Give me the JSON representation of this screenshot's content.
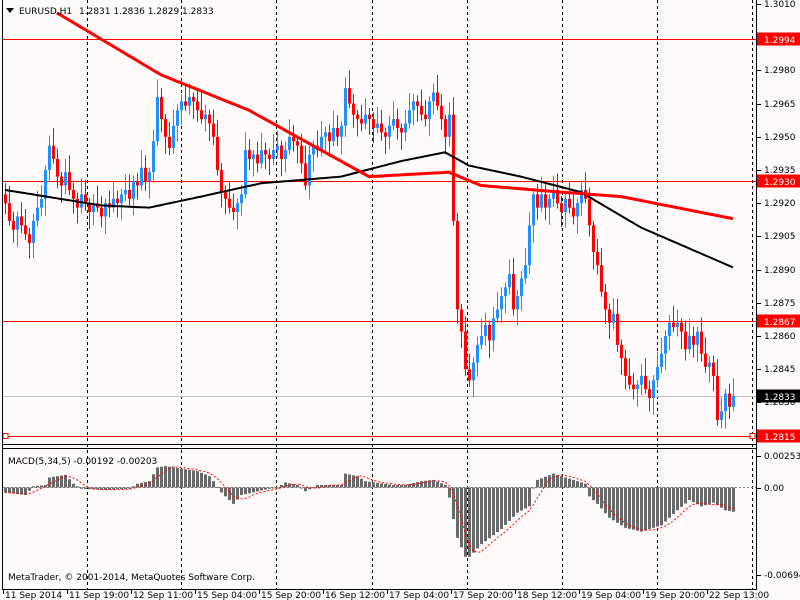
{
  "header": {
    "symbol": "EURUSD,H1",
    "ohlc": "1.2831 1.2836 1.2829 1.2833"
  },
  "macd_label": "MACD(5,34,5) -0.00192 -0.00203",
  "copyright": "MetaTrader, © 2001-2014, MetaQuotes Software Corp.",
  "colors": {
    "bull": "#1e90ff",
    "bear": "#ff0000",
    "background": "#fffafa",
    "ma_fast": "#000000",
    "ma_slow": "#ff0000",
    "hist": "#696969"
  },
  "chart_data": [
    {
      "type": "candlestick",
      "title": "EURUSD,H1",
      "ylim": [
        1.281,
        1.3012
      ],
      "price_ticks": [
        "1.3010",
        "1.2980",
        "1.2965",
        "1.2950",
        "1.2935",
        "1.2920",
        "1.2905",
        "1.2890",
        "1.2875",
        "1.2860",
        "1.2845",
        "1.2830"
      ],
      "time_labels": [
        "11 Sep 2014",
        "11 Sep 19:00",
        "12 Sep 11:00",
        "15 Sep 04:00",
        "15 Sep 20:00",
        "16 Sep 12:00",
        "17 Sep 04:00",
        "17 Sep 20:00",
        "18 Sep 12:00",
        "19 Sep 04:00",
        "19 Sep 20:00",
        "22 Sep 13:00"
      ],
      "time_label_bar_step": 16,
      "closes": [
        1.292,
        1.2912,
        1.2908,
        1.2914,
        1.291,
        1.2906,
        1.2902,
        1.2912,
        1.2918,
        1.2922,
        1.2935,
        1.2946,
        1.294,
        1.2932,
        1.2928,
        1.2934,
        1.2926,
        1.2922,
        1.2918,
        1.2924,
        1.292,
        1.2916,
        1.292,
        1.2918,
        1.2914,
        1.292,
        1.2918,
        1.2922,
        1.292,
        1.2924,
        1.2926,
        1.2922,
        1.293,
        1.2928,
        1.2936,
        1.293,
        1.2934,
        1.2948,
        1.2968,
        1.2958,
        1.295,
        1.2945,
        1.2955,
        1.2962,
        1.2966,
        1.2964,
        1.2968,
        1.2966,
        1.2962,
        1.2958,
        1.296,
        1.2956,
        1.295,
        1.2935,
        1.2925,
        1.2922,
        1.2918,
        1.2916,
        1.292,
        1.2924,
        1.2944,
        1.294,
        1.2942,
        1.2938,
        1.2944,
        1.2942,
        1.294,
        1.2944,
        1.2946,
        1.294,
        1.2944,
        1.295,
        1.2948,
        1.2946,
        1.2938,
        1.2928,
        1.2942,
        1.2946,
        1.2944,
        1.295,
        1.2952,
        1.2948,
        1.2954,
        1.295,
        1.2955,
        1.2972,
        1.2965,
        1.296,
        1.2958,
        1.2956,
        1.296,
        1.2958,
        1.2954,
        1.2956,
        1.2952,
        1.295,
        1.2955,
        1.2958,
        1.2954,
        1.2952,
        1.2956,
        1.2962,
        1.2966,
        1.2964,
        1.296,
        1.2958,
        1.2966,
        1.297,
        1.2964,
        1.2958,
        1.295,
        1.296,
        1.2912,
        1.2872,
        1.2862,
        1.2845,
        1.284,
        1.2848,
        1.2856,
        1.286,
        1.2865,
        1.2858,
        1.2868,
        1.2872,
        1.2878,
        1.2882,
        1.2888,
        1.2872,
        1.2878,
        1.2886,
        1.2892,
        1.291,
        1.2924,
        1.2918,
        1.2924,
        1.2918,
        1.2922,
        1.2926,
        1.292,
        1.2916,
        1.2922,
        1.2918,
        1.2914,
        1.292,
        1.2926,
        1.2922,
        1.291,
        1.2898,
        1.2892,
        1.288,
        1.2872,
        1.2866,
        1.287,
        1.2856,
        1.285,
        1.2842,
        1.2838,
        1.2836,
        1.2838,
        1.2842,
        1.2836,
        1.2832,
        1.284,
        1.2846,
        1.2852,
        1.286,
        1.2866,
        1.2864,
        1.2866,
        1.2862,
        1.2854,
        1.286,
        1.2856,
        1.2862,
        1.2852,
        1.2846,
        1.2848,
        1.2842,
        1.2822,
        1.2826,
        1.2834,
        1.2828,
        1.2833
      ],
      "ma_slow_keypoints": [
        [
          13,
          1.3006
        ],
        [
          39,
          1.2978
        ],
        [
          61,
          1.2962
        ],
        [
          74,
          1.2949
        ],
        [
          91,
          1.2932
        ],
        [
          111,
          1.2934
        ],
        [
          119,
          1.2928
        ],
        [
          139,
          1.2925
        ],
        [
          154,
          1.2923
        ],
        [
          182,
          1.2913
        ]
      ],
      "ma_fast_keypoints": [
        [
          0,
          1.2926
        ],
        [
          24,
          1.2919
        ],
        [
          36,
          1.2918
        ],
        [
          49,
          1.2923
        ],
        [
          64,
          1.2929
        ],
        [
          84,
          1.2932
        ],
        [
          99,
          1.2939
        ],
        [
          110,
          1.2943
        ],
        [
          116,
          1.2937
        ],
        [
          129,
          1.2932
        ],
        [
          144,
          1.2925
        ],
        [
          159,
          1.2909
        ],
        [
          182,
          1.2891
        ]
      ],
      "levels": [
        {
          "price": 1.2994,
          "label": "1.2994"
        },
        {
          "price": 1.293,
          "label": "1.2930"
        },
        {
          "price": 1.2867,
          "label": "1.2867"
        },
        {
          "price": 1.2815,
          "label": "1.2815"
        }
      ],
      "bid": {
        "price": 1.2833,
        "label": "1.2833"
      }
    },
    {
      "type": "bar",
      "title": "MACD(5,34,5)",
      "ylim": [
        -0.00694,
        0.00253
      ],
      "tick_labels": [
        "0.00253",
        "0.00",
        "-0.00694"
      ],
      "histogram_keypoints": [
        [
          0,
          -0.0004
        ],
        [
          5,
          -0.0006
        ],
        [
          7,
          0.0001
        ],
        [
          10,
          0.0002
        ],
        [
          11,
          0.0008
        ],
        [
          15,
          0.001
        ],
        [
          17,
          0.0003
        ],
        [
          19,
          -0.0001
        ],
        [
          25,
          -0.0002
        ],
        [
          31,
          -0.0001
        ],
        [
          33,
          0.0003
        ],
        [
          36,
          0.0005
        ],
        [
          38,
          0.0016
        ],
        [
          40,
          0.0017
        ],
        [
          48,
          0.0013
        ],
        [
          51,
          0.0009
        ],
        [
          52,
          0.0005
        ],
        [
          54,
          -0.0004
        ],
        [
          57,
          -0.0013
        ],
        [
          59,
          -0.0006
        ],
        [
          66,
          -0.0001
        ],
        [
          68,
          0
        ],
        [
          70,
          0.0004
        ],
        [
          73,
          0.0002
        ],
        [
          75,
          -0.0003
        ],
        [
          78,
          0.0002
        ],
        [
          84,
          0.0002
        ],
        [
          85,
          0.0011
        ],
        [
          88,
          0.0009
        ],
        [
          90,
          0.0005
        ],
        [
          97,
          0.0002
        ],
        [
          100,
          0.0002
        ],
        [
          104,
          0.0005
        ],
        [
          107,
          0.0006
        ],
        [
          110,
          0.0002
        ],
        [
          111,
          -0.0008
        ],
        [
          112,
          -0.0025
        ],
        [
          113,
          -0.004
        ],
        [
          115,
          -0.0055
        ],
        [
          116,
          -0.0055
        ],
        [
          119,
          -0.0045
        ],
        [
          124,
          -0.0033
        ],
        [
          128,
          -0.002
        ],
        [
          131,
          -0.0015
        ],
        [
          132,
          0
        ],
        [
          133,
          0.0006
        ],
        [
          137,
          0.0011
        ],
        [
          141,
          0.0007
        ],
        [
          145,
          0.0003
        ],
        [
          146,
          -0.0007
        ],
        [
          148,
          -0.0013
        ],
        [
          151,
          -0.0024
        ],
        [
          155,
          -0.0032
        ],
        [
          159,
          -0.0035
        ],
        [
          164,
          -0.003
        ],
        [
          168,
          -0.0018
        ],
        [
          171,
          -0.001
        ],
        [
          174,
          -0.0015
        ],
        [
          177,
          -0.0012
        ],
        [
          180,
          -0.0018
        ],
        [
          182,
          -0.00192
        ]
      ],
      "signal_period": 5
    }
  ]
}
